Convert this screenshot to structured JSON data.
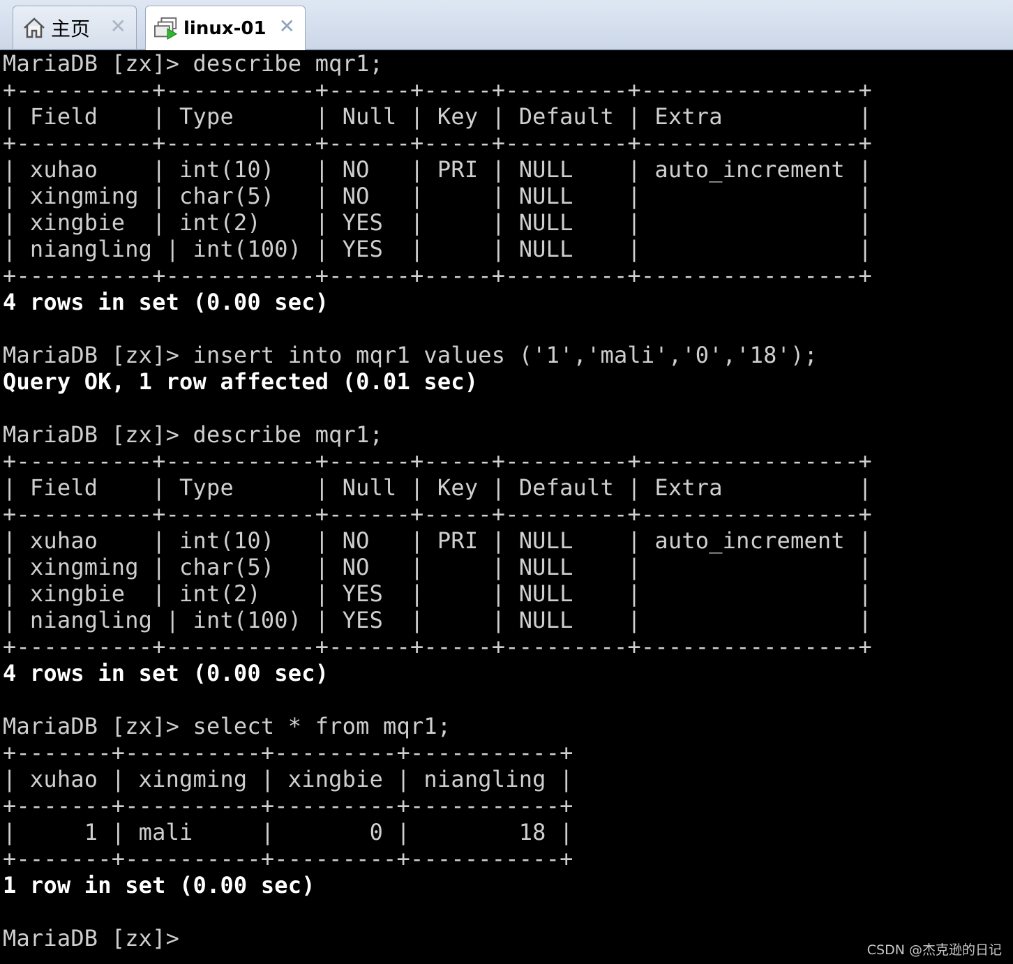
{
  "tabs": [
    {
      "label": "主页",
      "icon": "home-icon",
      "close": "✕"
    },
    {
      "label": "linux-01",
      "icon": "vm-icon",
      "close": "✕"
    }
  ],
  "terminal": {
    "lines": [
      "MariaDB [zx]> describe mqr1;",
      "+----------+-----------+------+-----+---------+----------------+",
      "| Field    | Type      | Null | Key | Default | Extra          |",
      "+----------+-----------+------+-----+---------+----------------+",
      "| xuhao    | int(10)   | NO   | PRI | NULL    | auto_increment |",
      "| xingming | char(5)   | NO   |     | NULL    |                |",
      "| xingbie  | int(2)    | YES  |     | NULL    |                |",
      "| niangling | int(100) | YES  |     | NULL    |                |",
      "+----------+-----------+------+-----+---------+----------------+",
      "4 rows in set (0.00 sec)",
      "",
      "MariaDB [zx]> insert into mqr1 values ('1','mali','0','18');",
      "Query OK, 1 row affected (0.01 sec)",
      "",
      "MariaDB [zx]> describe mqr1;",
      "+----------+-----------+------+-----+---------+----------------+",
      "| Field    | Type      | Null | Key | Default | Extra          |",
      "+----------+-----------+------+-----+---------+----------------+",
      "| xuhao    | int(10)   | NO   | PRI | NULL    | auto_increment |",
      "| xingming | char(5)   | NO   |     | NULL    |                |",
      "| xingbie  | int(2)    | YES  |     | NULL    |                |",
      "| niangling | int(100) | YES  |     | NULL    |                |",
      "+----------+-----------+------+-----+---------+----------------+",
      "4 rows in set (0.00 sec)",
      "",
      "MariaDB [zx]> select * from mqr1;",
      "+-------+----------+---------+-----------+",
      "| xuhao | xingming | xingbie | niangling |",
      "+-------+----------+---------+-----------+",
      "|     1 | mali     |       0 |        18 |",
      "+-------+----------+---------+-----------+",
      "1 row in set (0.00 sec)",
      "",
      "MariaDB [zx]>"
    ]
  },
  "watermark": "CSDN @杰克逊的日记"
}
